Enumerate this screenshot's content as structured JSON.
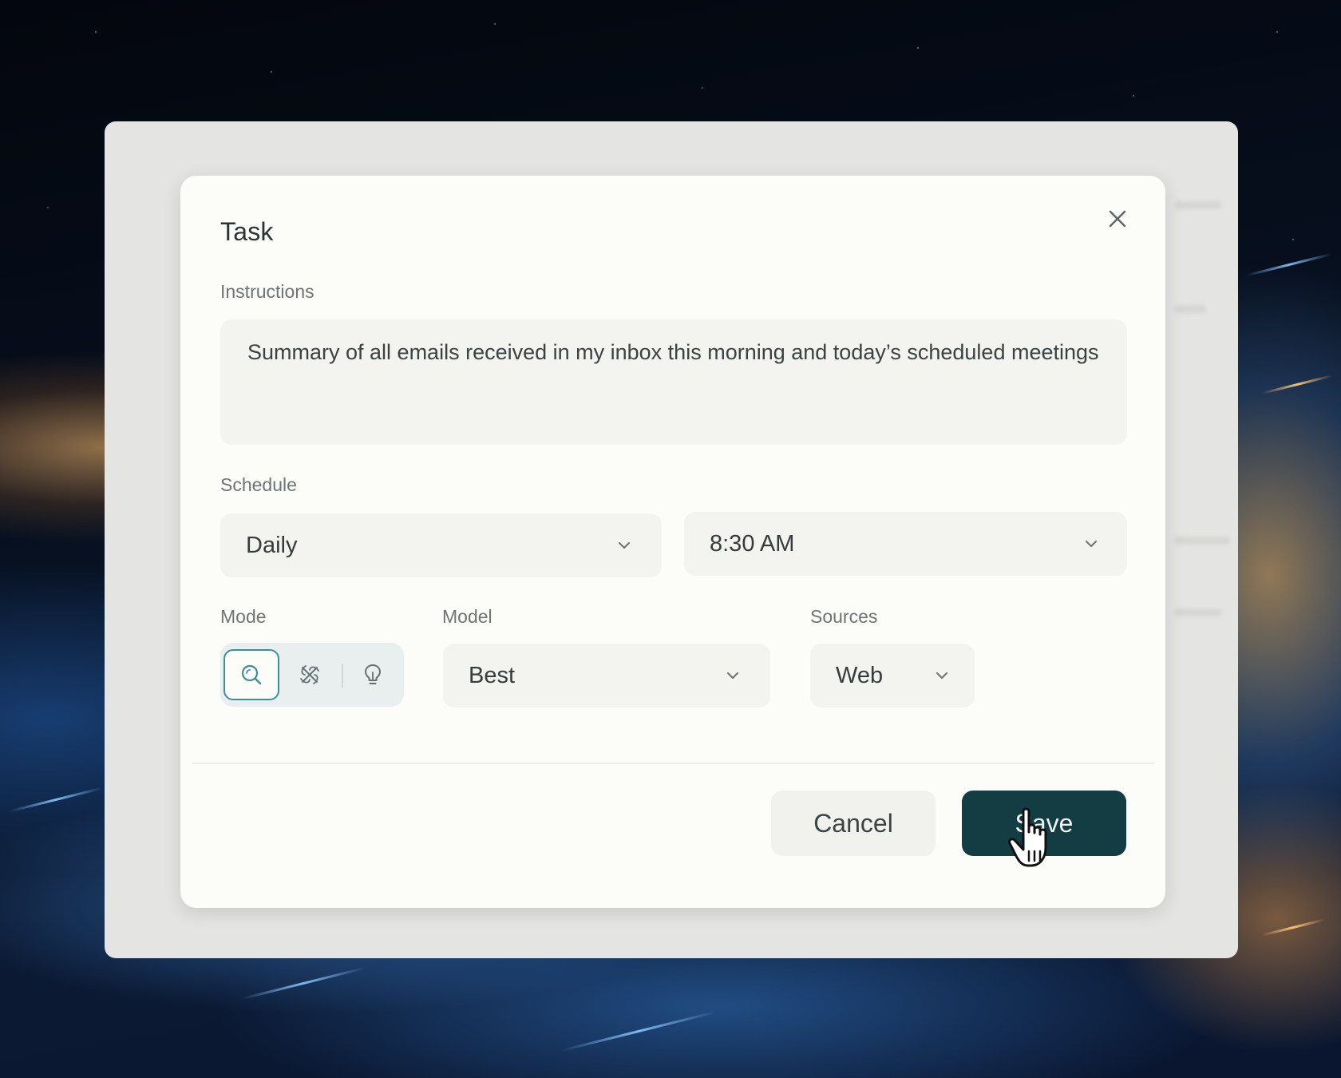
{
  "dialog": {
    "title": "Task",
    "close_icon": "close-icon"
  },
  "instructions": {
    "label": "Instructions",
    "value": "Summary of all emails received in my inbox this morning and today’s scheduled meetings"
  },
  "schedule": {
    "label": "Schedule",
    "frequency": "Daily",
    "time": "8:30 AM"
  },
  "mode": {
    "label": "Mode",
    "options": [
      {
        "icon": "search-icon",
        "selected": true
      },
      {
        "icon": "research-icon",
        "selected": false
      },
      {
        "icon": "lightbulb-icon",
        "selected": false
      }
    ]
  },
  "model": {
    "label": "Model",
    "value": "Best"
  },
  "sources": {
    "label": "Sources",
    "value": "Web"
  },
  "actions": {
    "cancel": "Cancel",
    "save": "Save"
  },
  "colors": {
    "primary": "#133c43",
    "mode_active_border": "#3f8e94",
    "dialog_bg": "#fcfcf9",
    "field_bg": "#f3f3f0"
  }
}
